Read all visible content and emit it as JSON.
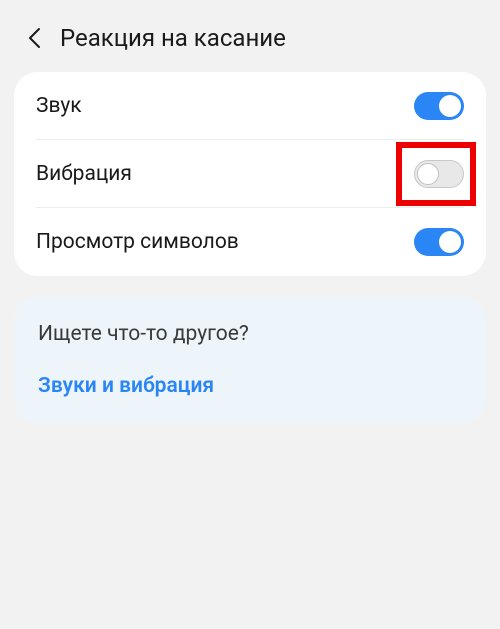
{
  "header": {
    "title": "Реакция на касание"
  },
  "settings": {
    "sound": {
      "label": "Звук",
      "enabled": true
    },
    "vibration": {
      "label": "Вибрация",
      "enabled": false,
      "highlighted": true
    },
    "charPreview": {
      "label": "Просмотр символов",
      "enabled": true
    }
  },
  "infoCard": {
    "heading": "Ищете что-то другое?",
    "link": "Звуки и вибрация"
  }
}
